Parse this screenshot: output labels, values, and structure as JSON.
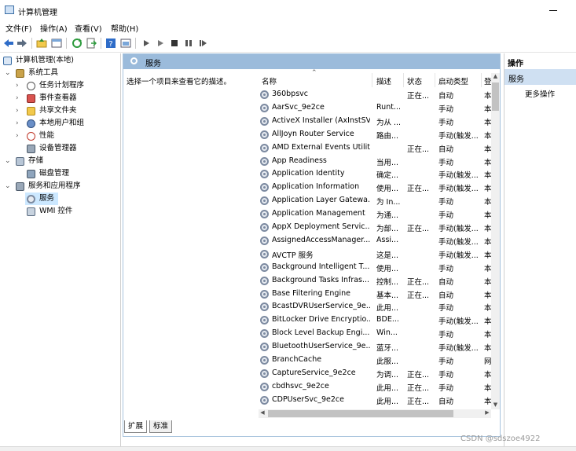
{
  "window": {
    "title": "计算机管理"
  },
  "menu": [
    "文件(F)",
    "操作(A)",
    "查看(V)",
    "帮助(H)"
  ],
  "toolbar_icons": [
    "back-icon",
    "forward-icon",
    "up-folder-icon",
    "show-tree-icon",
    "refresh-icon",
    "export-icon",
    "help-icon",
    "properties-icon",
    "play-icon",
    "play-alt-icon",
    "stop-icon",
    "pause-icon",
    "restart-icon"
  ],
  "tree": {
    "root": "计算机管理(本地)",
    "system_tools": "系统工具",
    "task_scheduler": "任务计划程序",
    "event_viewer": "事件查看器",
    "shared_folders": "共享文件夹",
    "local_users": "本地用户和组",
    "performance": "性能",
    "device_manager": "设备管理器",
    "storage": "存储",
    "disk_management": "磁盘管理",
    "services_apps": "服务和应用程序",
    "services": "服务",
    "wmi": "WMI 控件"
  },
  "center": {
    "header_title": "服务",
    "description": "选择一个项目来查看它的描述。",
    "columns": {
      "name": "名称",
      "desc": "描述",
      "status": "状态",
      "startup": "启动类型",
      "logon": "登"
    },
    "services": [
      {
        "name": "360bpsvc",
        "desc": "",
        "status": "正在...",
        "startup": "自动",
        "logon": "本"
      },
      {
        "name": "AarSvc_9e2ce",
        "desc": "Runt...",
        "status": "",
        "startup": "手动",
        "logon": "本"
      },
      {
        "name": "ActiveX Installer (AxInstSV)",
        "desc": "为从 ...",
        "status": "",
        "startup": "手动",
        "logon": "本"
      },
      {
        "name": "AllJoyn Router Service",
        "desc": "路由...",
        "status": "",
        "startup": "手动(触发...",
        "logon": "本"
      },
      {
        "name": "AMD External Events Utility",
        "desc": "",
        "status": "正在...",
        "startup": "自动",
        "logon": "本"
      },
      {
        "name": "App Readiness",
        "desc": "当用...",
        "status": "",
        "startup": "手动",
        "logon": "本"
      },
      {
        "name": "Application Identity",
        "desc": "确定...",
        "status": "",
        "startup": "手动(触发...",
        "logon": "本"
      },
      {
        "name": "Application Information",
        "desc": "使用...",
        "status": "正在...",
        "startup": "手动(触发...",
        "logon": "本"
      },
      {
        "name": "Application Layer Gatewa...",
        "desc": "为 In...",
        "status": "",
        "startup": "手动",
        "logon": "本"
      },
      {
        "name": "Application Management",
        "desc": "为通...",
        "status": "",
        "startup": "手动",
        "logon": "本"
      },
      {
        "name": "AppX Deployment Servic...",
        "desc": "为部...",
        "status": "正在...",
        "startup": "手动(触发...",
        "logon": "本"
      },
      {
        "name": "AssignedAccessManager...",
        "desc": "Assi...",
        "status": "",
        "startup": "手动(触发...",
        "logon": "本"
      },
      {
        "name": "AVCTP 服务",
        "desc": "这是...",
        "status": "",
        "startup": "手动(触发...",
        "logon": "本"
      },
      {
        "name": "Background Intelligent T...",
        "desc": "使用...",
        "status": "",
        "startup": "手动",
        "logon": "本"
      },
      {
        "name": "Background Tasks Infras...",
        "desc": "控制...",
        "status": "正在...",
        "startup": "自动",
        "logon": "本"
      },
      {
        "name": "Base Filtering Engine",
        "desc": "基本...",
        "status": "正在...",
        "startup": "自动",
        "logon": "本"
      },
      {
        "name": "BcastDVRUserService_9e...",
        "desc": "此用...",
        "status": "",
        "startup": "手动",
        "logon": "本"
      },
      {
        "name": "BitLocker Drive Encryptio...",
        "desc": "BDE...",
        "status": "",
        "startup": "手动(触发...",
        "logon": "本"
      },
      {
        "name": "Block Level Backup Engi...",
        "desc": "Win...",
        "status": "",
        "startup": "手动",
        "logon": "本"
      },
      {
        "name": "BluetoothUserService_9e...",
        "desc": "蓝牙...",
        "status": "",
        "startup": "手动(触发...",
        "logon": "本"
      },
      {
        "name": "BranchCache",
        "desc": "此服...",
        "status": "",
        "startup": "手动",
        "logon": "网"
      },
      {
        "name": "CaptureService_9e2ce",
        "desc": "为调...",
        "status": "正在...",
        "startup": "手动",
        "logon": "本"
      },
      {
        "name": "cbdhsvc_9e2ce",
        "desc": "此用...",
        "status": "正在...",
        "startup": "手动",
        "logon": "本"
      },
      {
        "name": "CDPUserSvc_9e2ce",
        "desc": "此用...",
        "status": "正在...",
        "startup": "自动",
        "logon": "本"
      }
    ]
  },
  "tabs": [
    "扩展",
    "标准"
  ],
  "actions": {
    "title": "操作",
    "group": "服务",
    "more": "更多操作"
  },
  "watermark": "CSDN @sdszoe4922",
  "colors": {
    "pane_header": "#9bbbdb",
    "selection": "#cce8ff",
    "actions_group": "#cfe0f2"
  }
}
